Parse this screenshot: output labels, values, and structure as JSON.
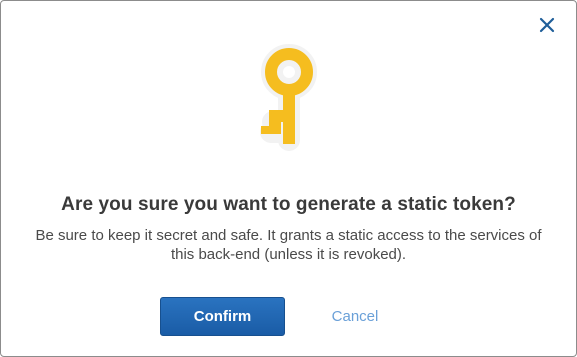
{
  "dialog": {
    "close_icon": "close-icon",
    "illustration_icon": "key-icon",
    "title": "Are you sure you want to generate a static token?",
    "message_line1": "Be sure to keep it secret and safe. It grants a static access to the services of",
    "message_line2": "this back-end (unless it is revoked).",
    "confirm_label": "Confirm",
    "cancel_label": "Cancel"
  },
  "colors": {
    "key": "#f5bd1f",
    "close": "#1f5e99",
    "confirm_bg": "#1e62ad",
    "cancel_text": "#6aa0d8",
    "title_text": "#3a3a3a"
  }
}
